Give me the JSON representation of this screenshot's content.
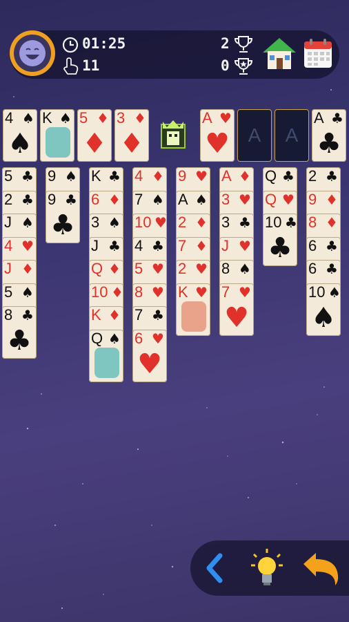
{
  "header": {
    "time": "01:25",
    "moves": "11",
    "wins": "2",
    "star_wins": "0"
  },
  "icons": {
    "timer": "clock-icon",
    "moves": "hand-pointer-icon",
    "wins": "trophy-icon",
    "star": "star-trophy-icon",
    "home": "home-icon",
    "calendar": "calendar-icon",
    "back": "chevron-left-icon",
    "hint": "lightbulb-icon",
    "undo": "undo-arrow-icon"
  },
  "colors": {
    "red_suit": "#e0312a",
    "black_suit": "#111111",
    "avatar_ring": "#f0a020"
  },
  "free_cells": [
    {
      "rank": "4",
      "suit": "♠"
    },
    {
      "rank": "K",
      "suit": "♠"
    },
    {
      "rank": "5",
      "suit": "♦"
    },
    {
      "rank": "3",
      "suit": "♦"
    }
  ],
  "foundations": [
    {
      "rank": "A",
      "suit": "♥",
      "filled": true
    },
    {
      "rank": "A",
      "suit": "",
      "filled": false
    },
    {
      "rank": "A",
      "suit": "",
      "filled": false
    },
    {
      "rank": "A",
      "suit": "♣",
      "filled": true
    }
  ],
  "columns": [
    [
      {
        "r": "5",
        "s": "♣"
      },
      {
        "r": "2",
        "s": "♣"
      },
      {
        "r": "J",
        "s": "♠"
      },
      {
        "r": "4",
        "s": "♥"
      },
      {
        "r": "J",
        "s": "♦"
      },
      {
        "r": "5",
        "s": "♠"
      },
      {
        "r": "8",
        "s": "♣"
      }
    ],
    [
      {
        "r": "9",
        "s": "♠"
      },
      {
        "r": "9",
        "s": "♣"
      }
    ],
    [
      {
        "r": "K",
        "s": "♣"
      },
      {
        "r": "6",
        "s": "♦"
      },
      {
        "r": "3",
        "s": "♠"
      },
      {
        "r": "J",
        "s": "♣"
      },
      {
        "r": "Q",
        "s": "♦"
      },
      {
        "r": "10",
        "s": "♦"
      },
      {
        "r": "K",
        "s": "♦"
      },
      {
        "r": "Q",
        "s": "♠"
      }
    ],
    [
      {
        "r": "4",
        "s": "♦"
      },
      {
        "r": "7",
        "s": "♠"
      },
      {
        "r": "10",
        "s": "♥"
      },
      {
        "r": "4",
        "s": "♣"
      },
      {
        "r": "5",
        "s": "♥"
      },
      {
        "r": "8",
        "s": "♥"
      },
      {
        "r": "7",
        "s": "♣"
      },
      {
        "r": "6",
        "s": "♥"
      }
    ],
    [
      {
        "r": "9",
        "s": "♥"
      },
      {
        "r": "A",
        "s": "♠"
      },
      {
        "r": "2",
        "s": "♦"
      },
      {
        "r": "7",
        "s": "♦"
      },
      {
        "r": "2",
        "s": "♥"
      },
      {
        "r": "K",
        "s": "♥"
      }
    ],
    [
      {
        "r": "A",
        "s": "♦"
      },
      {
        "r": "3",
        "s": "♥"
      },
      {
        "r": "3",
        "s": "♣"
      },
      {
        "r": "J",
        "s": "♥"
      },
      {
        "r": "8",
        "s": "♠"
      },
      {
        "r": "7",
        "s": "♥"
      }
    ],
    [
      {
        "r": "Q",
        "s": "♣"
      },
      {
        "r": "Q",
        "s": "♥"
      },
      {
        "r": "10",
        "s": "♣"
      }
    ],
    [
      {
        "r": "2",
        "s": "♣"
      },
      {
        "r": "9",
        "s": "♦"
      },
      {
        "r": "8",
        "s": "♦"
      },
      {
        "r": "6",
        "s": "♣"
      },
      {
        "r": "6",
        "s": "♣"
      },
      {
        "r": "10",
        "s": "♠"
      }
    ]
  ]
}
